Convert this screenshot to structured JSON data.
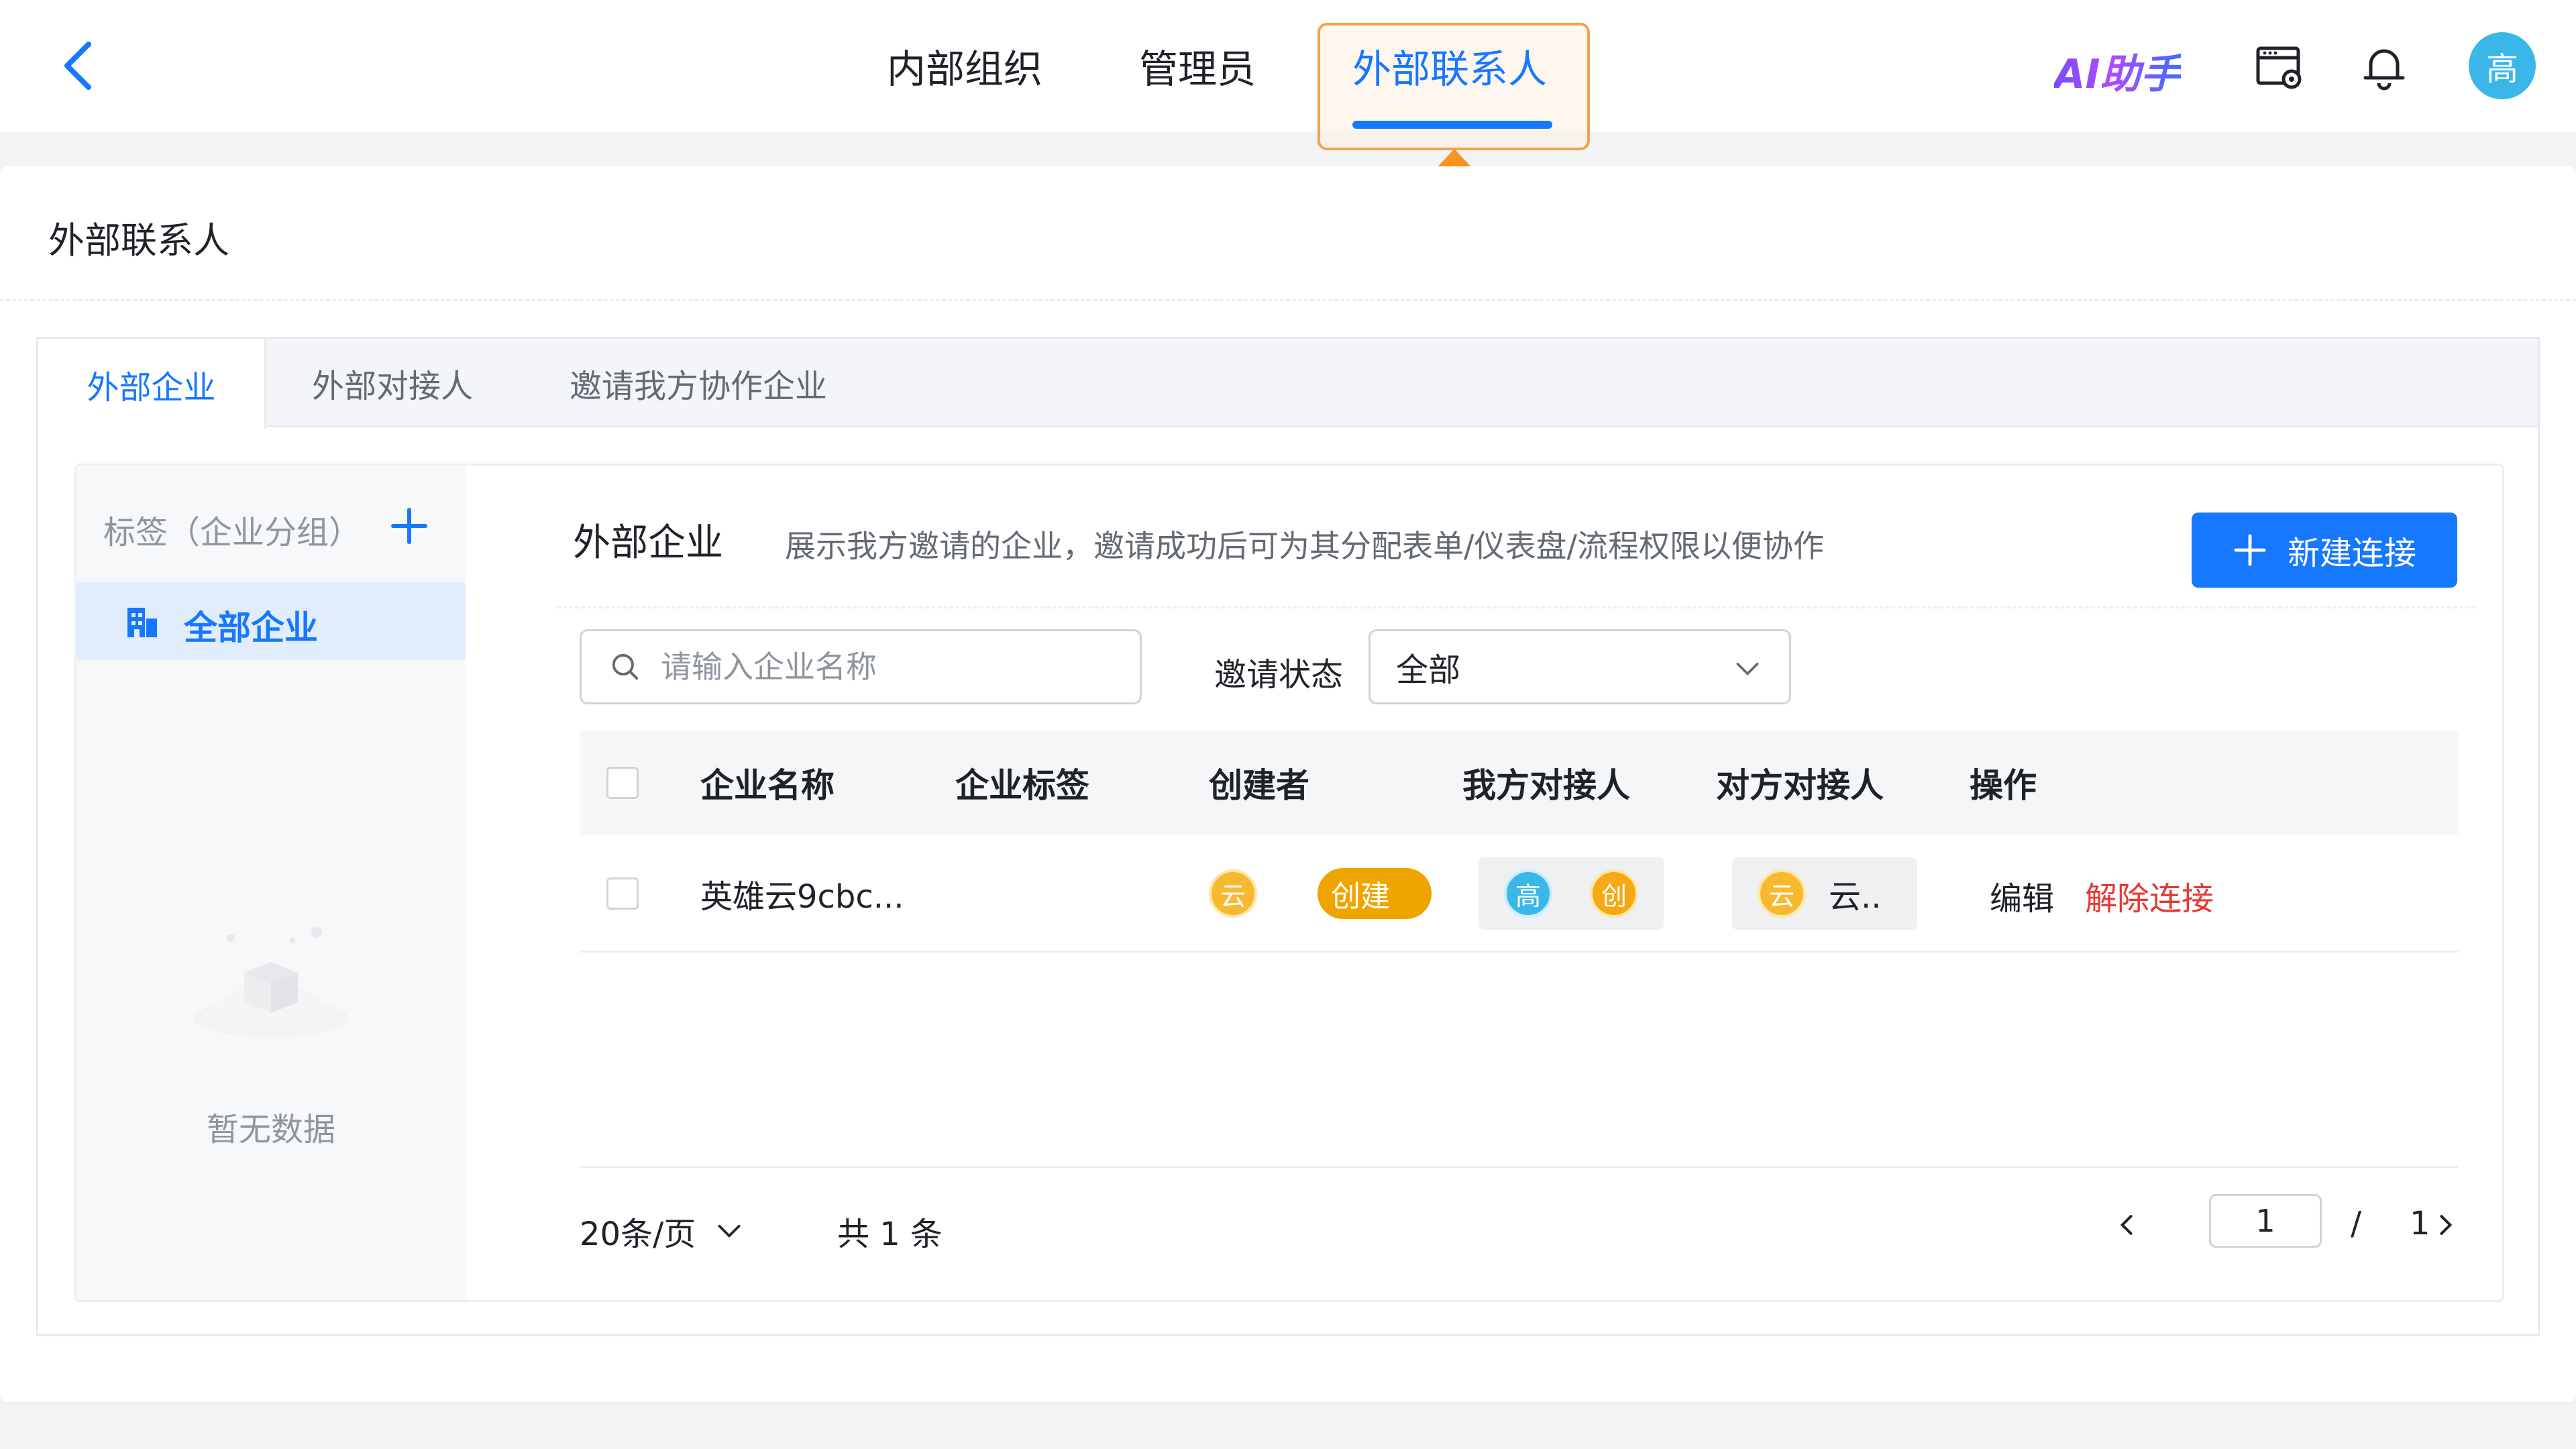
{
  "header": {
    "tabs": [
      {
        "label": "内部组织"
      },
      {
        "label": "管理员"
      },
      {
        "label": "外部联系人"
      }
    ],
    "ai_logo": "AI助手",
    "avatar_text": "高",
    "icons": [
      "back-icon",
      "settings-panel-icon",
      "bell-icon"
    ],
    "highlight_color": "#f5a14a",
    "accent_color": "#1677ff"
  },
  "page": {
    "title": "外部联系人",
    "subtabs": [
      {
        "label": "外部企业"
      },
      {
        "label": "外部对接人"
      },
      {
        "label": "邀请我方协作企业"
      }
    ]
  },
  "groups": {
    "title": "标签（企业分组）",
    "items": [
      {
        "label": "全部企业"
      }
    ],
    "empty_text": "暂无数据"
  },
  "section": {
    "title": "外部企业",
    "description": "展示我方邀请的企业，邀请成功后可为其分配表单/仪表盘/流程权限以便协作",
    "new_button": "新建连接"
  },
  "filters": {
    "search_placeholder": "请输入企业名称",
    "status_label": "邀请状态",
    "status_value": "全部"
  },
  "table": {
    "columns": [
      "企业名称",
      "企业标签",
      "创建者",
      "我方对接人",
      "对方对接人",
      "操作"
    ],
    "rows": [
      {
        "name": "英雄云9cbc...",
        "tag": "",
        "creator_avatar": "云",
        "creator_badge": "创建",
        "our_contact_avatars": [
          "高",
          "创"
        ],
        "their_contact_avatar": "云",
        "their_contact_name": "云..",
        "actions": [
          "编辑",
          "解除连接"
        ]
      }
    ]
  },
  "pagination": {
    "page_size": "20条/页",
    "total": "共 1 条",
    "current_page": "1",
    "separator": "/",
    "total_pages": "1"
  }
}
